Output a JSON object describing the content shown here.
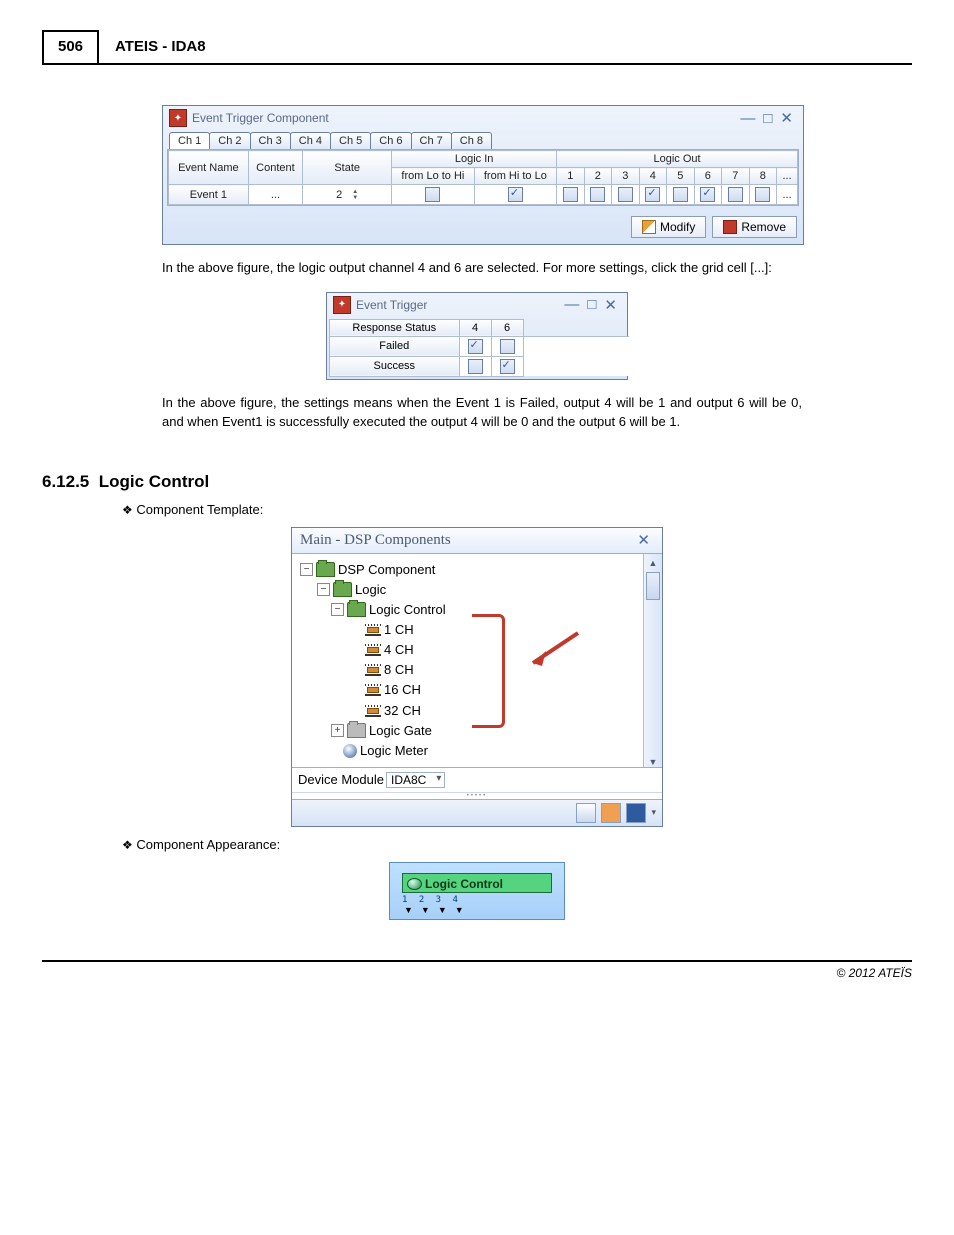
{
  "header": {
    "page_number": "506",
    "title": "ATEIS - IDA8"
  },
  "win1": {
    "title": "Event Trigger Component",
    "tabs": [
      "Ch 1",
      "Ch 2",
      "Ch 3",
      "Ch 4",
      "Ch 5",
      "Ch 6",
      "Ch 7",
      "Ch 8"
    ],
    "cols": {
      "event_name": "Event Name",
      "content": "Content",
      "state": "State",
      "logic_in": "Logic In",
      "lo_hi": "from Lo to Hi",
      "hi_lo": "from Hi to Lo",
      "logic_out": "Logic Out",
      "out": [
        "1",
        "2",
        "3",
        "4",
        "5",
        "6",
        "7",
        "8",
        "..."
      ]
    },
    "row": {
      "name": "Event 1",
      "content": "...",
      "state": "2",
      "lo_hi_checked": false,
      "hi_lo_checked": true,
      "out_checked": [
        false,
        false,
        false,
        true,
        false,
        true,
        false,
        false
      ],
      "out_more": "..."
    },
    "buttons": {
      "modify": "Modify",
      "remove": "Remove"
    }
  },
  "para1": "In the above figure, the logic output channel 4 and 6 are selected. For more settings, click the grid cell [...]:",
  "win2": {
    "title": "Event Trigger",
    "rs": "Response Status",
    "cols": [
      "4",
      "6"
    ],
    "rows": [
      {
        "label": "Failed",
        "c1": true,
        "c2": false
      },
      {
        "label": "Success",
        "c1": false,
        "c2": true
      }
    ]
  },
  "para2": "In the above figure, the settings means when the Event 1 is Failed, output 4 will be 1 and output 6 will be 0, and when Event1 is successfully executed the output 4 will be 0 and the output 6 will be 1.",
  "section": {
    "num": "6.12.5",
    "title": "Logic Control"
  },
  "bullet1": "Component Template:",
  "bullet2": "Component Appearance:",
  "win3": {
    "title": "Main - DSP Components",
    "tree": {
      "root": "DSP Component",
      "logic": "Logic",
      "logic_control": "Logic Control",
      "ch": [
        "1 CH",
        "4 CH",
        "8 CH",
        "16 CH",
        "32 CH"
      ],
      "logic_gate": "Logic Gate",
      "logic_meter": "Logic Meter"
    },
    "device_label": "Device Module",
    "device_value": "IDA8C"
  },
  "comp": {
    "label": "Logic Control",
    "nums": "1 2 3 4"
  },
  "footer": "© 2012 ATEÏS"
}
